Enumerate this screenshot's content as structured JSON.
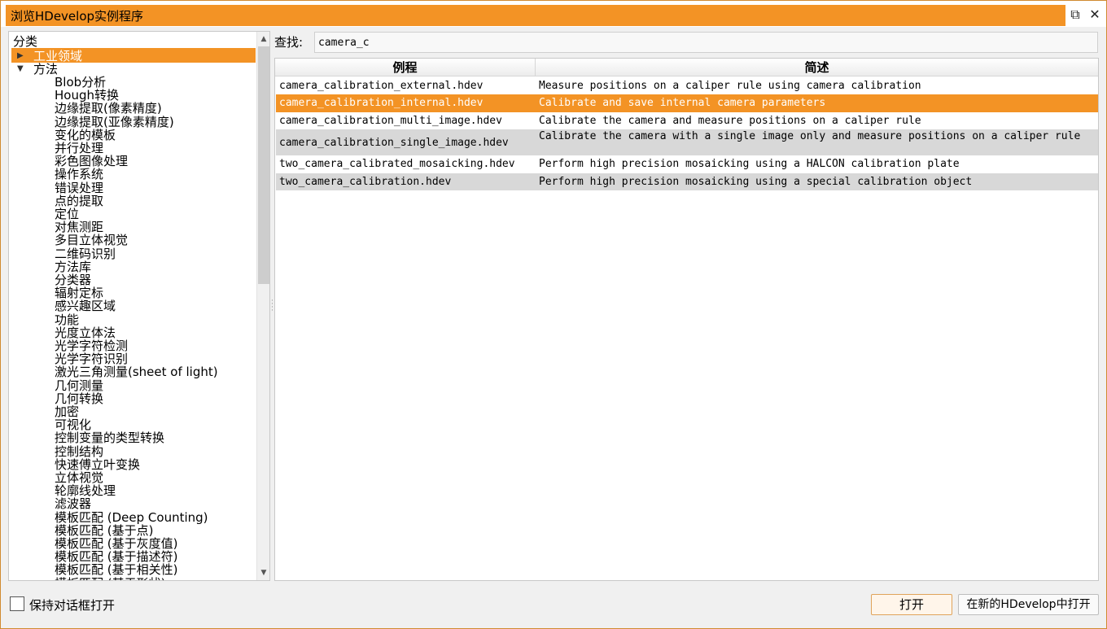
{
  "window": {
    "title": "浏览HDevelop实例程序",
    "restore_glyph": "⧉",
    "close_glyph": "✕"
  },
  "tree": {
    "header": "分类",
    "top_items": [
      {
        "label": "工业领域",
        "expanded": false,
        "selected": true
      },
      {
        "label": "方法",
        "expanded": true,
        "selected": false
      }
    ],
    "method_children": [
      "Blob分析",
      "Hough转换",
      "边缘提取(像素精度)",
      "边缘提取(亚像素精度)",
      "变化的模板",
      "并行处理",
      "彩色图像处理",
      "操作系统",
      "错误处理",
      "点的提取",
      "定位",
      "对焦测距",
      "多目立体视觉",
      "二维码识别",
      "方法库",
      "分类器",
      "辐射定标",
      "感兴趣区域",
      "功能",
      "光度立体法",
      "光学字符检测",
      "光学字符识别",
      "激光三角测量(sheet of light)",
      "几何测量",
      "几何转换",
      "加密",
      "可视化",
      "控制变量的类型转换",
      "控制结构",
      "快速傅立叶变换",
      "立体视觉",
      "轮廓线处理",
      "滤波器",
      "模板匹配 (Deep Counting)",
      "模板匹配 (基于点)",
      "模板匹配 (基于灰度值)",
      "模板匹配 (基于描述符)",
      "模板匹配 (基于相关性)",
      "模板匹配 (基于形状)"
    ]
  },
  "search": {
    "label": "查找:",
    "value": "camera_c"
  },
  "table": {
    "columns": [
      "例程",
      "简述"
    ],
    "rows": [
      {
        "file": "camera_calibration_external.hdev",
        "desc": "Measure positions on a caliper rule using camera calibration",
        "state": "normal"
      },
      {
        "file": "camera_calibration_internal.hdev",
        "desc": "Calibrate and save internal camera parameters",
        "state": "selected"
      },
      {
        "file": "camera_calibration_multi_image.hdev",
        "desc": "Calibrate the camera and measure positions on a caliper rule",
        "state": "normal"
      },
      {
        "file": "camera_calibration_single_image.hdev",
        "desc": "Calibrate the camera with a single image only and measure positions on a caliper rule",
        "state": "alt"
      },
      {
        "file": "two_camera_calibrated_mosaicking.hdev",
        "desc": "Perform high precision mosaicking using a HALCON calibration plate",
        "state": "normal"
      },
      {
        "file": "two_camera_calibration.hdev",
        "desc": "Perform high precision mosaicking using a special calibration object",
        "state": "alt"
      }
    ]
  },
  "footer": {
    "keep_open_label": "保持对话框打开",
    "keep_open_checked": false,
    "open_button": "打开",
    "open_new_button": "在新的HDevelop中打开"
  },
  "colors": {
    "accent": "#f39325",
    "row_alt": "#d8d8d8"
  }
}
